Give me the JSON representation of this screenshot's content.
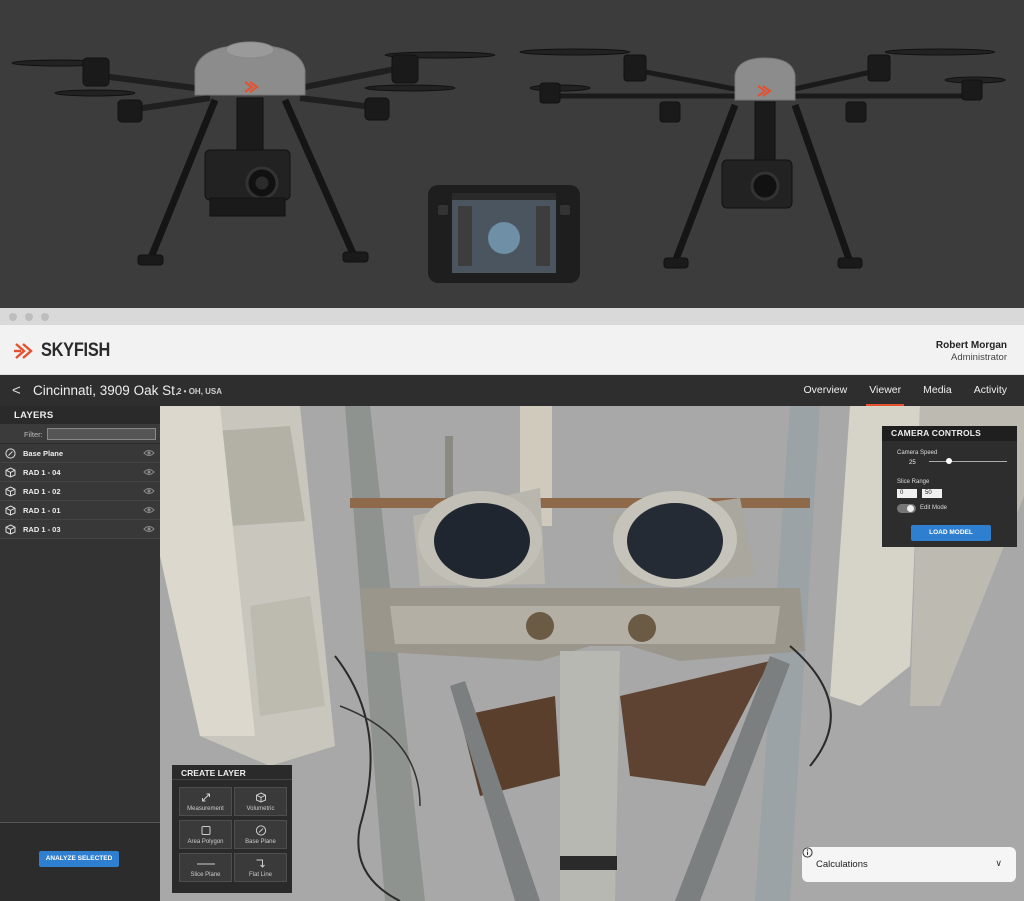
{
  "brand": {
    "name": "SKYFISH",
    "accent": "#e5512f"
  },
  "user": {
    "name": "Robert Morgan",
    "role": "Administrator"
  },
  "nav": {
    "location_title": "Cincinnati, 3909 Oak St.",
    "location_sub": "2 • OH, USA",
    "tabs": [
      {
        "label": "Overview",
        "active": false
      },
      {
        "label": "Viewer",
        "active": true
      },
      {
        "label": "Media",
        "active": false
      },
      {
        "label": "Activity",
        "active": false
      }
    ]
  },
  "layers": {
    "heading": "LAYERS",
    "filter_label": "Filter:",
    "filter_value": "",
    "items": [
      {
        "label": "Base Plane",
        "icon": "compass-icon"
      },
      {
        "label": "RAD 1 - 04",
        "icon": "cube-icon"
      },
      {
        "label": "RAD 1 - 02",
        "icon": "cube-icon"
      },
      {
        "label": "RAD 1 - 01",
        "icon": "cube-icon"
      },
      {
        "label": "RAD 1 - 03",
        "icon": "cube-icon"
      }
    ],
    "analyze_label": "ANALYZE SELECTED"
  },
  "camera_controls": {
    "heading": "CAMERA CONTROLS",
    "speed_label": "Camera Speed",
    "speed_value": "25",
    "slice_label": "Slice Range",
    "slice_min": "0",
    "slice_max": "50",
    "edit_mode_label": "Edit Mode",
    "edit_mode_on": true,
    "load_label": "LOAD MODEL"
  },
  "create_layer": {
    "heading": "CREATE LAYER",
    "tools": [
      {
        "label": "Measurement",
        "icon": "measure-arrows-icon"
      },
      {
        "label": "Volumetric",
        "icon": "cube-icon"
      },
      {
        "label": "Area Polygon",
        "icon": "square-icon"
      },
      {
        "label": "Base Plane",
        "icon": "compass-icon"
      },
      {
        "label": "Slice Plane",
        "icon": "line-icon"
      },
      {
        "label": "Flat Line",
        "icon": "corner-arrow-icon"
      }
    ]
  },
  "calculations": {
    "label": "Calculations"
  }
}
